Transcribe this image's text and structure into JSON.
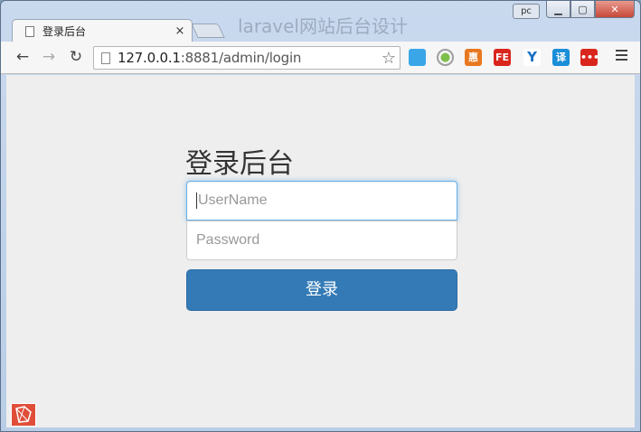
{
  "window": {
    "background_title": "laravel网站后台设计",
    "user_badge": "pc"
  },
  "tab": {
    "title": "登录后台",
    "close_glyph": "×"
  },
  "toolbar": {
    "back_glyph": "←",
    "forward_glyph": "→",
    "reload_glyph": "↻",
    "url_host": "127.0.0.1",
    "url_rest": ":8881/admin/login",
    "star_glyph": "☆",
    "extensions": [
      {
        "name": "pin-extension-icon",
        "label": "",
        "color": "#3aa6e8"
      },
      {
        "name": "record-extension-icon",
        "label": "●",
        "color": "#9e9e9e"
      },
      {
        "name": "hui-extension-icon",
        "label": "惠",
        "color": "#e8781f"
      },
      {
        "name": "fe-extension-icon",
        "label": "FE",
        "color": "#d9261c"
      },
      {
        "name": "y-extension-icon",
        "label": "Y",
        "color": "#ffffff"
      },
      {
        "name": "translate-extension-icon",
        "label": "译",
        "color": "#1a8fd8"
      },
      {
        "name": "dots-extension-icon",
        "label": "•••",
        "color": "#d9261c"
      }
    ]
  },
  "login": {
    "title": "登录后台",
    "username_placeholder": "UserName",
    "password_placeholder": "Password",
    "submit_label": "登录"
  },
  "colors": {
    "primary_button": "#337ab7",
    "page_background": "#eeeeee",
    "focus_border": "#66afe9"
  }
}
